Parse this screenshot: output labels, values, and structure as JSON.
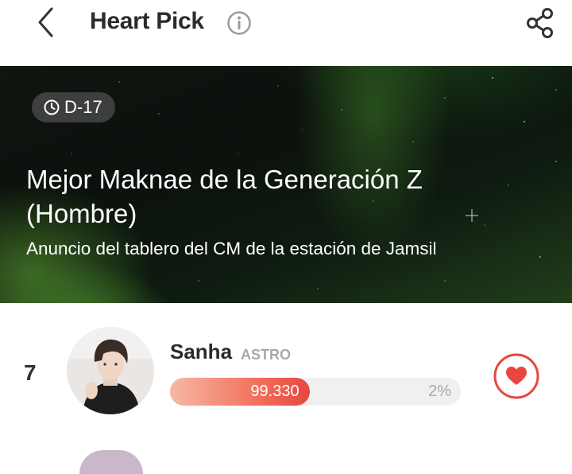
{
  "header": {
    "title": "Heart Pick"
  },
  "banner": {
    "dday": "D-17",
    "title": "Mejor Maknae de la Generación Z (Hombre)",
    "subtitle": "Anuncio del tablero del CM de la estación de Jamsil"
  },
  "candidates": [
    {
      "rank": "7",
      "name": "Sanha",
      "group": "ASTRO",
      "votes": "99.330",
      "percent": "2%",
      "bar_fill_fraction": 0.48
    }
  ],
  "colors": {
    "accent": "#e8463f",
    "bar_start": "#f7b8a6",
    "banner_green": "#4a8e2e"
  }
}
